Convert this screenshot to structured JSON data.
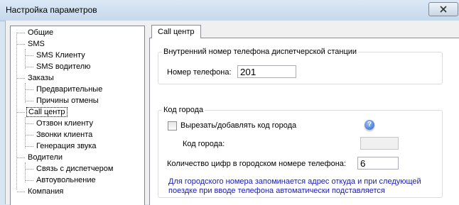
{
  "window": {
    "title": "Настройка параметров",
    "close_icon": "close-icon"
  },
  "tree": {
    "items": [
      {
        "label": "Общие",
        "level": 0
      },
      {
        "label": "SMS",
        "level": 0
      },
      {
        "label": "SMS Клиенту",
        "level": 1
      },
      {
        "label": "SMS водителю",
        "level": 1
      },
      {
        "label": "Заказы",
        "level": 0
      },
      {
        "label": "Предварительные",
        "level": 1
      },
      {
        "label": "Причины отмены",
        "level": 1
      },
      {
        "label": "Call центр",
        "level": 0,
        "selected": true
      },
      {
        "label": "Отзвон клиенту",
        "level": 1
      },
      {
        "label": "Звонки клиента",
        "level": 1
      },
      {
        "label": "Генерация звука",
        "level": 1
      },
      {
        "label": "Водители",
        "level": 0
      },
      {
        "label": "Связь с диспетчером",
        "level": 1
      },
      {
        "label": "Автоувольнение",
        "level": 1
      },
      {
        "label": "Компания",
        "level": 0
      }
    ]
  },
  "tab": {
    "label": "Call центр"
  },
  "internal_group": {
    "title": "Внутренний номер телефона диспетчерской станции",
    "phone_label": "Номер телефона:",
    "phone_value": "201"
  },
  "city_group": {
    "title": "Код города",
    "checkbox_label": "Вырезать/добавлять код города",
    "checkbox_checked": false,
    "code_label": "Код города:",
    "code_value": "",
    "digits_label": "Количество цифр в городском номере телефона:",
    "digits_value": "6",
    "note_line1": "Для городского номера запоминается адрес откуда и при следующей",
    "note_line2": "поездке при вводе телефона автоматически подставляется",
    "help_icon": "help-icon"
  },
  "colors": {
    "note": "#1a1ab4",
    "selection": "#000000",
    "title_bar": "#c6d8ec"
  }
}
